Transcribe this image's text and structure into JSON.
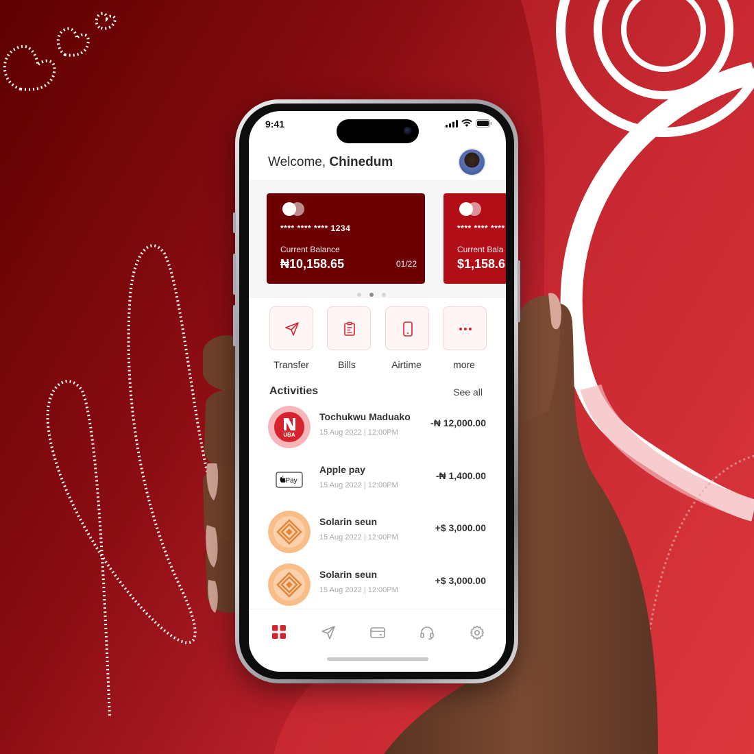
{
  "status_bar": {
    "time": "9:41"
  },
  "header": {
    "greeting": "Welcome,",
    "user_name": "Chinedum"
  },
  "cards": [
    {
      "number": "**** **** **** 1234",
      "balance_label": "Current Balance",
      "balance": "₦10,158.65",
      "expiry": "01/22",
      "color": "#6c0003"
    },
    {
      "number": "**** **** ****",
      "balance_label": "Current Bala",
      "balance": "$1,158.65",
      "color": "#b10e18"
    }
  ],
  "carousel": {
    "pages": 3,
    "active_index": 1
  },
  "quick_actions": [
    {
      "label": "Transfer",
      "icon": "send-icon"
    },
    {
      "label": "Bills",
      "icon": "bill-icon"
    },
    {
      "label": "Airtime",
      "icon": "phone-icon"
    },
    {
      "label": "more",
      "icon": "more-icon"
    }
  ],
  "activities": {
    "title": "Activities",
    "see_all": "See all",
    "items": [
      {
        "name": "Tochukwu Maduako",
        "date": "15 Aug 2022 | 12:00PM",
        "amount": "-₦ 12,000.00",
        "avatar": "uba-logo",
        "avatar_text": "UBA"
      },
      {
        "name": "Apple pay",
        "date": "15 Aug 2022 | 12:00PM",
        "amount": "-₦ 1,400.00",
        "avatar": "apple-pay-logo",
        "avatar_text": "Pay"
      },
      {
        "name": "Solarin seun",
        "date": "15 Aug 2022 | 12:00PM",
        "amount": "+$ 3,000.00",
        "avatar": "diamond-logo"
      },
      {
        "name": "Solarin seun",
        "date": "15 Aug 2022 | 12:00PM",
        "amount": "+$ 3,000.00",
        "avatar": "diamond-logo"
      }
    ]
  },
  "bottom_nav": [
    {
      "icon": "grid-icon",
      "active": true
    },
    {
      "icon": "send-icon",
      "active": false
    },
    {
      "icon": "card-icon",
      "active": false
    },
    {
      "icon": "headset-icon",
      "active": false
    },
    {
      "icon": "gear-icon",
      "active": false
    }
  ],
  "colors": {
    "brand_red": "#d6232d",
    "card_dark": "#6c0003",
    "card_red": "#b10e18"
  }
}
